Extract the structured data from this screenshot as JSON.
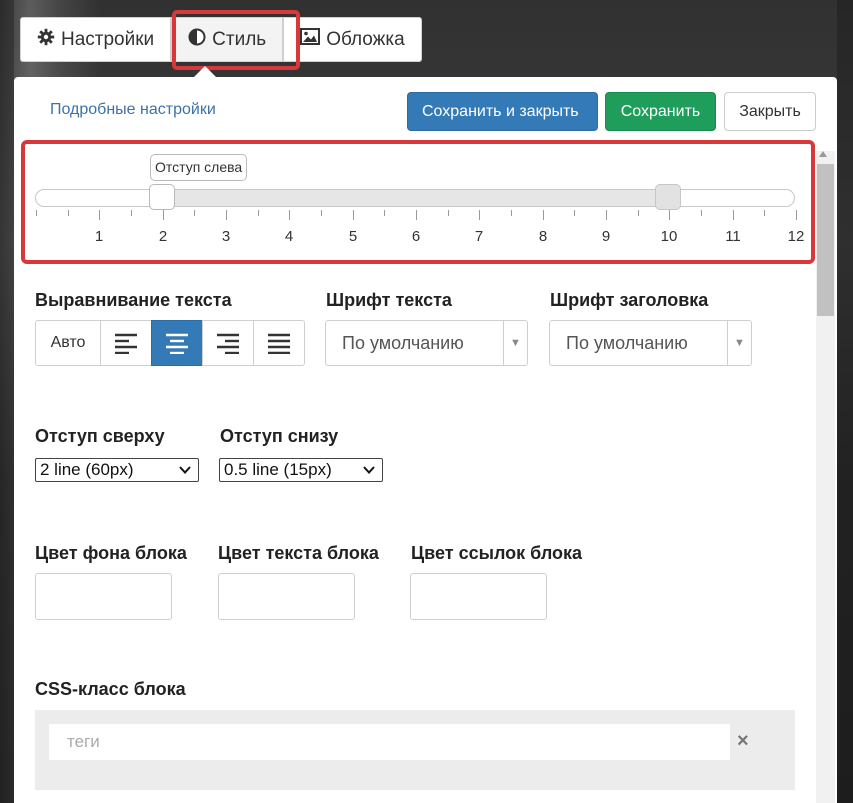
{
  "tabs": [
    {
      "label": "Настройки",
      "icon": "gear-icon"
    },
    {
      "label": "Стиль",
      "icon": "half-circle-icon"
    },
    {
      "label": "Обложка",
      "icon": "image-icon"
    }
  ],
  "active_tab": "Стиль",
  "header": {
    "advanced_link": "Подробные настройки",
    "save_close_label": "Сохранить и закрыть",
    "save_label": "Сохранить",
    "close_label": "Закрыть"
  },
  "slider": {
    "tooltip": "Отступ слева",
    "ticks": [
      "1",
      "2",
      "3",
      "4",
      "5",
      "6",
      "7",
      "8",
      "9",
      "10",
      "11",
      "12"
    ],
    "min": 0,
    "max": 12,
    "value_left": 2,
    "value_right": 10
  },
  "text_align": {
    "label": "Выравнивание текста",
    "auto_label": "Авто",
    "options": [
      "left-align-icon",
      "center-align-icon",
      "right-align-icon",
      "justify-align-icon"
    ],
    "active": "center-align-icon"
  },
  "text_font": {
    "label": "Шрифт текста",
    "value": "По умолчанию"
  },
  "heading_font": {
    "label": "Шрифт заголовка",
    "value": "По умолчанию"
  },
  "padding_top": {
    "label": "Отступ сверху",
    "value": "2 line (60px)"
  },
  "padding_bottom": {
    "label": "Отступ снизу",
    "value": "0.5 line (15px)"
  },
  "colors": {
    "bg_label": "Цвет фона блока",
    "text_label": "Цвет текста блока",
    "link_label": "Цвет ссылок блока"
  },
  "css_class": {
    "label": "CSS-класс блока",
    "placeholder": "теги",
    "clear": "×"
  },
  "theme": {
    "primary": "#337ab7",
    "success": "#1e9e5a",
    "highlight": "#d9383a"
  }
}
